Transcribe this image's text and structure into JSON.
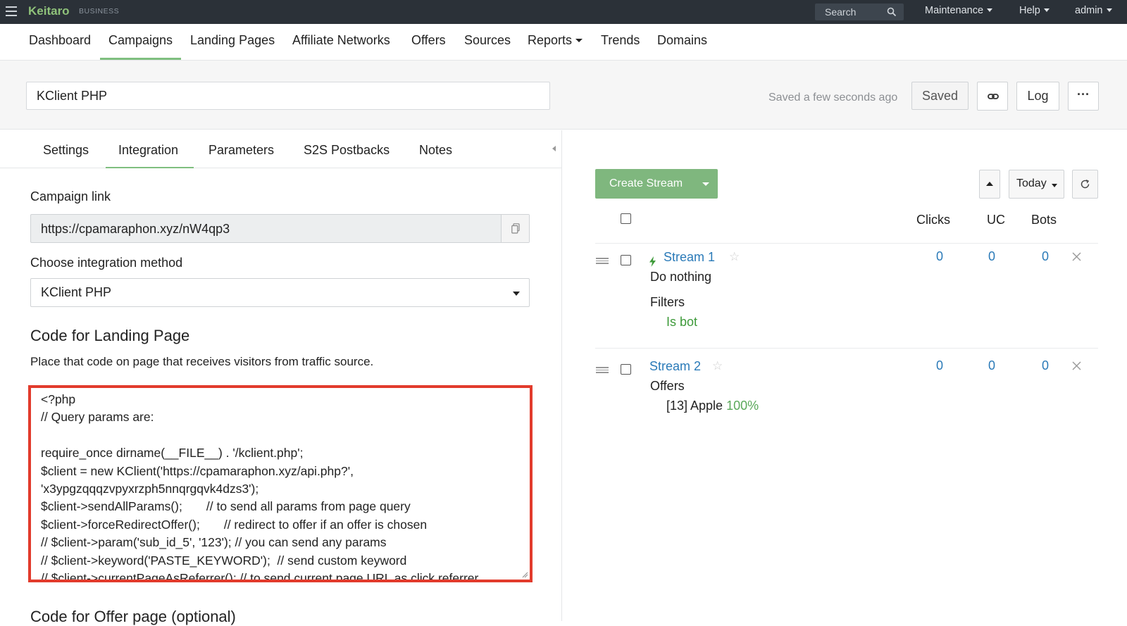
{
  "topbar": {
    "brand": "Keitaro",
    "brand_sub": "BUSINESS",
    "search_placeholder": "Search",
    "menu": [
      "Maintenance",
      "Help",
      "admin"
    ]
  },
  "nav": {
    "items": [
      "Dashboard",
      "Campaigns",
      "Landing Pages",
      "Affiliate Networks",
      "Offers",
      "Sources",
      "Reports",
      "Trends",
      "Domains"
    ],
    "active": "Campaigns"
  },
  "header": {
    "campaign_name": "KClient PHP",
    "saved_status": "Saved a few seconds ago",
    "saved_button": "Saved",
    "log_button": "Log",
    "more_button": "···"
  },
  "tabs": {
    "items": [
      "Settings",
      "Integration",
      "Parameters",
      "S2S Postbacks",
      "Notes"
    ],
    "active": "Integration"
  },
  "integration": {
    "campaign_link_label": "Campaign link",
    "campaign_link": "https://cpamaraphon.xyz/nW4qp3",
    "method_label": "Choose integration method",
    "method_value": "KClient PHP",
    "code_heading": "Code for Landing Page",
    "code_desc": "Place that code on page that receives visitors from traffic source.",
    "code_lines": [
      "<?php",
      "// Query params are:",
      "",
      "require_once dirname(__FILE__) . '/kclient.php';",
      "$client = new KClient('https://cpamaraphon.xyz/api.php?',",
      "'x3ypgzqqqzvpyxrzph5nnqrgqvk4dzs3');",
      "$client->sendAllParams();       // to send all params from page query",
      "$client->forceRedirectOffer();       // redirect to offer if an offer is chosen",
      "// $client->param('sub_id_5', '123'); // you can send any params",
      "// $client->keyword('PASTE_KEYWORD');  // send custom keyword",
      "// $client->currentPageAsReferrer(); // to send current page URL as click referrer"
    ],
    "offer_heading": "Code for Offer page (optional)"
  },
  "streams_panel": {
    "create_button": "Create Stream",
    "period": "Today",
    "columns": [
      "Clicks",
      "UC",
      "Bots"
    ],
    "streams": [
      {
        "name": "Stream 1",
        "action": "Do nothing",
        "section": "Filters",
        "detail": "Is bot",
        "clicks": "0",
        "uc": "0",
        "bots": "0"
      },
      {
        "name": "Stream 2",
        "section": "Offers",
        "detail": "[13] Apple",
        "detail_pct": "100%",
        "clicks": "0",
        "uc": "0",
        "bots": "0"
      }
    ]
  },
  "colors": {
    "topbar_bg": "#2b3138",
    "brand_green": "#8fc27a",
    "accent_green": "#7fb77e",
    "link_blue": "#2a7ab8",
    "highlight_red": "#e23b2c"
  }
}
